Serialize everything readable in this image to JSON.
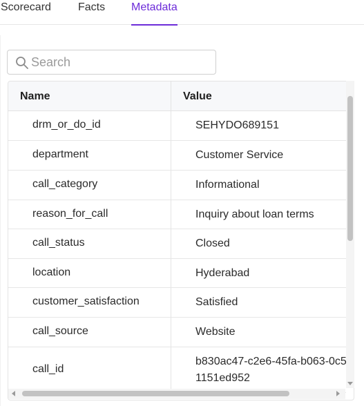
{
  "tabs": [
    {
      "label": "Scorecard",
      "active": false
    },
    {
      "label": "Facts",
      "active": false
    },
    {
      "label": "Metadata",
      "active": true
    }
  ],
  "search": {
    "placeholder": "Search",
    "value": "",
    "icon": "search-icon"
  },
  "table": {
    "headers": {
      "name": "Name",
      "value": "Value"
    },
    "rows": [
      {
        "name": "drm_or_do_id",
        "value": "SEHYDO689151"
      },
      {
        "name": "department",
        "value": "Customer Service"
      },
      {
        "name": "call_category",
        "value": "Informational"
      },
      {
        "name": "reason_for_call",
        "value": "Inquiry about loan terms"
      },
      {
        "name": "call_status",
        "value": "Closed"
      },
      {
        "name": "location",
        "value": "Hyderabad"
      },
      {
        "name": "customer_satisfaction",
        "value": "Satisfied"
      },
      {
        "name": "call_source",
        "value": "Website"
      },
      {
        "name": "call_id",
        "value": "b830ac47-c2e6-45fa-b063-0c51151ed952"
      }
    ]
  },
  "colors": {
    "accent": "#6c2bd9",
    "border": "#e3e3e3",
    "header_bg": "#f7f8fa"
  }
}
